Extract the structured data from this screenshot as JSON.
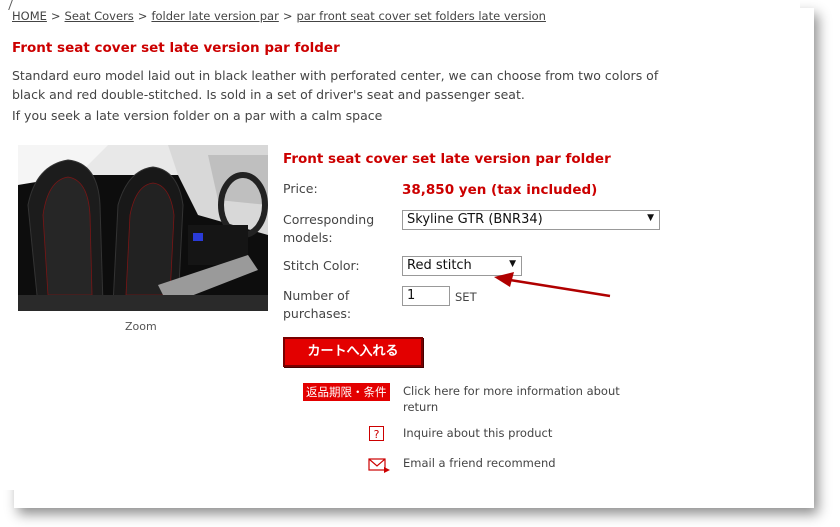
{
  "breadcrumb": {
    "home": "HOME",
    "sep": ">",
    "seat_covers": "Seat Covers",
    "folder": "folder late version par",
    "current": "par front seat cover set folders late version"
  },
  "page_title": "Front seat cover set late version par folder",
  "description": "Standard euro model laid out in black leather with perforated center, we can choose from two colors of black and red double-stitched. Is sold in a set of driver's seat and passenger seat.",
  "description2": "If you seek a late version folder on a par with a calm space",
  "image": {
    "zoom_label": "Zoom"
  },
  "product": {
    "title": "Front seat cover set late version par folder",
    "price_label": "Price:",
    "price_value": "38,850 yen (tax included)",
    "models_label": "Corresponding models:",
    "models_value": "Skyline GTR (BNR34)",
    "stitch_label": "Stitch Color:",
    "stitch_value": "Red stitch",
    "qty_label": "Number of purchases:",
    "qty_value": "1",
    "qty_unit": "SET",
    "cart_button": "カートへ入れる"
  },
  "links": {
    "return_badge": "返品期限・条件",
    "return_text": "Click here for more information about return",
    "inquire_icon": "?",
    "inquire_text": "Inquire about this product",
    "email_text": "Email a friend recommend"
  },
  "colors": {
    "accent": "#cc0000",
    "cart_bg": "#e30000",
    "annotation_arrow": "#b00000"
  }
}
